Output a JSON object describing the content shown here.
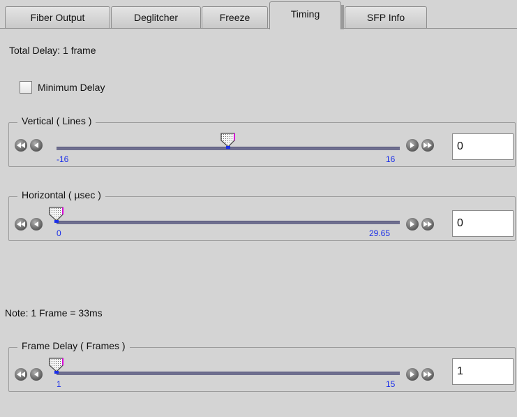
{
  "tabs": [
    {
      "label": "Fiber Output",
      "active": false
    },
    {
      "label": "Deglitcher",
      "active": false
    },
    {
      "label": "Freeze",
      "active": false
    },
    {
      "label": "Timing",
      "active": true
    },
    {
      "label": "SFP Info",
      "active": false
    }
  ],
  "total_delay": "Total Delay: 1 frame",
  "minimum_delay": {
    "label": "Minimum Delay",
    "checked": false
  },
  "vertical": {
    "title": "Vertical ( Lines )",
    "min_label": "-16",
    "max_label": "16",
    "value": "0",
    "position_fraction": 0.5
  },
  "horizontal": {
    "title": "Horizontal ( µsec )",
    "min_label": "0",
    "max_label": "29.65",
    "value": "0",
    "position_fraction": 0.0
  },
  "note": "Note: 1 Frame = 33ms",
  "frame_delay": {
    "title": "Frame Delay ( Frames )",
    "min_label": "1",
    "max_label": "15",
    "value": "1",
    "position_fraction": 0.0
  },
  "colors": {
    "track": "#6f6f8f",
    "tick_label": "#1a2ee8",
    "thumb_accent": "#d800d8",
    "background": "#d4d4d4"
  },
  "icons": {
    "fast_back": "double-left-arrow",
    "back": "left-arrow",
    "forward": "right-arrow",
    "fast_forward": "double-right-arrow"
  }
}
